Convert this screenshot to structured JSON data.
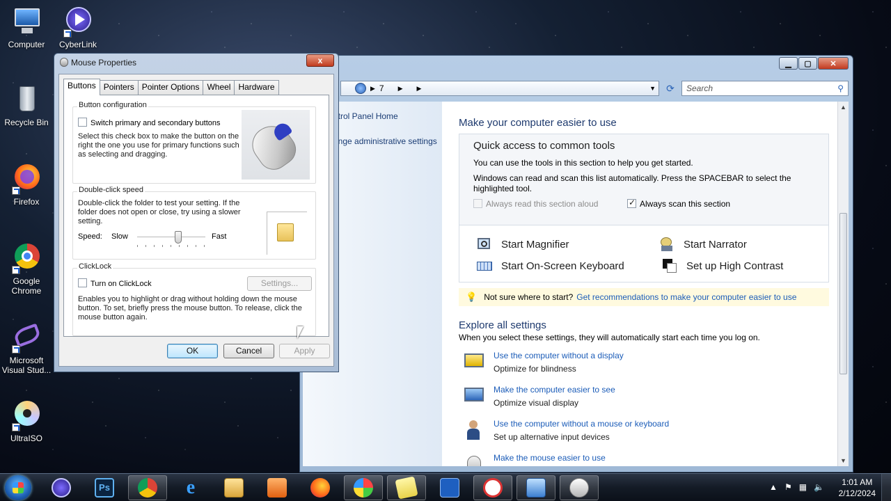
{
  "desktop": {
    "icons": [
      {
        "label": "Computer",
        "icon": "computer-icon"
      },
      {
        "label": "CyberLink",
        "icon": "cyberlink-icon"
      },
      {
        "label": "Recycle Bin",
        "icon": "recycle-bin-icon"
      },
      {
        "label": "Firefox",
        "icon": "firefox-icon"
      },
      {
        "label": "Google Chrome",
        "icon": "chrome-icon"
      },
      {
        "label": "Microsoft Visual Stud...",
        "icon": "visual-studio-icon"
      },
      {
        "label": "UltraISO",
        "icon": "ultraiso-icon"
      }
    ]
  },
  "control_panel": {
    "address": {
      "crumb": "7"
    },
    "search_placeholder": "Search",
    "left_links": [
      "ntrol Panel Home",
      "ange administrative settings"
    ],
    "heading": "Make your computer easier to use",
    "quick_access": {
      "title": "Quick access to common tools",
      "line1": "You can use the tools in this section to help you get started.",
      "line2": "Windows can read and scan this list automatically.  Press the SPACEBAR to select the highlighted tool.",
      "read_aloud": "Always read this section aloud",
      "read_aloud_checked": false,
      "scan": "Always scan this section",
      "scan_checked": true,
      "tools": [
        {
          "label": "Start Magnifier",
          "icon": "magnifier-icon"
        },
        {
          "label": "Start Narrator",
          "icon": "narrator-icon"
        },
        {
          "label": "Start On-Screen Keyboard",
          "icon": "keyboard-icon"
        },
        {
          "label": "Set up High Contrast",
          "icon": "high-contrast-icon"
        }
      ]
    },
    "tip": {
      "text": "Not sure where to start?",
      "link": "Get recommendations to make your computer easier to use"
    },
    "explore": {
      "heading": "Explore all settings",
      "subtext": "When you select these settings, they will automatically start each time you log on.",
      "items": [
        {
          "link": "Use the computer without a display",
          "desc": "Optimize for blindness"
        },
        {
          "link": "Make the computer easier to see",
          "desc": "Optimize visual display"
        },
        {
          "link": "Use the computer without a mouse or keyboard",
          "desc": "Set up alternative input devices"
        },
        {
          "link": "Make the mouse easier to use",
          "desc": ""
        }
      ]
    }
  },
  "mouse_dialog": {
    "title": "Mouse Properties",
    "close": "x",
    "tabs": [
      "Buttons",
      "Pointers",
      "Pointer Options",
      "Wheel",
      "Hardware"
    ],
    "button_config": {
      "label": "Button configuration",
      "switch_label": "Switch primary and secondary buttons",
      "switch_checked": false,
      "desc": "Select this check box to make the button on the right the one you use for primary functions such as selecting and dragging."
    },
    "double_click": {
      "label": "Double-click speed",
      "desc": "Double-click the folder to test your setting. If the folder does not open or close, try using a slower setting.",
      "speed_label": "Speed:",
      "slow": "Slow",
      "fast": "Fast",
      "level": 0.6
    },
    "clicklock": {
      "label": "ClickLock",
      "toggle_label": "Turn on ClickLock",
      "checked": false,
      "settings_button": "Settings...",
      "desc": "Enables you to highlight or drag without holding down the mouse button. To set, briefly press the mouse button. To release, click the mouse button again."
    },
    "buttons": {
      "ok": "OK",
      "cancel": "Cancel",
      "apply": "Apply"
    }
  },
  "taskbar": {
    "apps": [
      "cyberlink-icon",
      "photoshop-icon",
      "chrome-icon",
      "ie-icon",
      "explorer-icon",
      "media-icon",
      "firefox-icon",
      "windows-icon",
      "sticky-notes-icon",
      "visual-studio-icon",
      "snipping-icon",
      "control-panel-icon",
      "mouse-icon"
    ],
    "ps_label": "Ps",
    "time": "1:01 AM",
    "date": "2/12/2024"
  }
}
